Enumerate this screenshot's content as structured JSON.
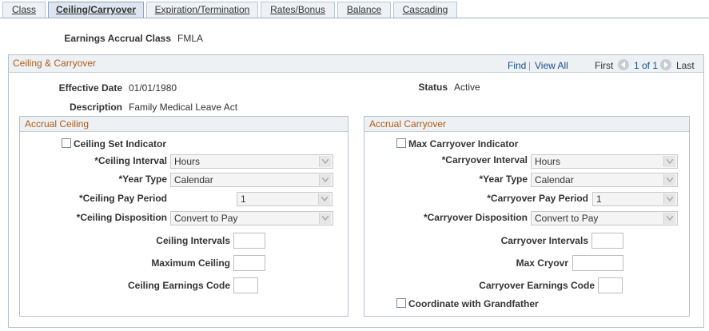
{
  "tabs": [
    {
      "label": "Class"
    },
    {
      "label": "Ceiling/Carryover"
    },
    {
      "label": "Expiration/Termination"
    },
    {
      "label": "Rates/Bonus"
    },
    {
      "label": "Balance"
    },
    {
      "label": "Cascading"
    }
  ],
  "earnings_accrual_class": {
    "label": "Earnings Accrual Class",
    "value": "FMLA"
  },
  "section": {
    "title": "Ceiling & Carryover",
    "find": "Find",
    "view_all": "View All",
    "first": "First",
    "page_info": "1 of 1",
    "last": "Last",
    "effective_date_label": "Effective Date",
    "effective_date": "01/01/1980",
    "status_label": "Status",
    "status": "Active",
    "description_label": "Description",
    "description": "Family Medical Leave Act"
  },
  "accrual_ceiling": {
    "title": "Accrual Ceiling",
    "indicator_label": "Ceiling Set Indicator",
    "interval_label": "*Ceiling Interval",
    "interval_value": "Hours",
    "year_type_label": "*Year Type",
    "year_type_value": "Calendar",
    "pay_period_label": "*Ceiling Pay Period",
    "pay_period_value": "1",
    "disposition_label": "*Ceiling Disposition",
    "disposition_value": "Convert to Pay",
    "intervals_label": "Ceiling Intervals",
    "intervals_value": "",
    "maximum_label": "Maximum Ceiling",
    "maximum_value": "",
    "earnings_code_label": "Ceiling Earnings Code",
    "earnings_code_value": ""
  },
  "accrual_carryover": {
    "title": "Accrual Carryover",
    "indicator_label": "Max Carryover Indicator",
    "interval_label": "*Carryover Interval",
    "interval_value": "Hours",
    "year_type_label": "*Year Type",
    "year_type_value": "Calendar",
    "pay_period_label": "*Carryover Pay Period",
    "pay_period_value": "1",
    "disposition_label": "*Carryover Disposition",
    "disposition_value": "Convert to Pay",
    "intervals_label": "Carryover Intervals",
    "intervals_value": "",
    "max_label": "Max Cryovr",
    "max_value": "",
    "earnings_code_label": "Carryover Earnings Code",
    "earnings_code_value": "",
    "grandfather_label": "Coordinate with Grandfather"
  },
  "colors": {
    "header_text": "#b05a17",
    "link": "#1a4f8f",
    "tab_bg": "#eef2f6"
  }
}
